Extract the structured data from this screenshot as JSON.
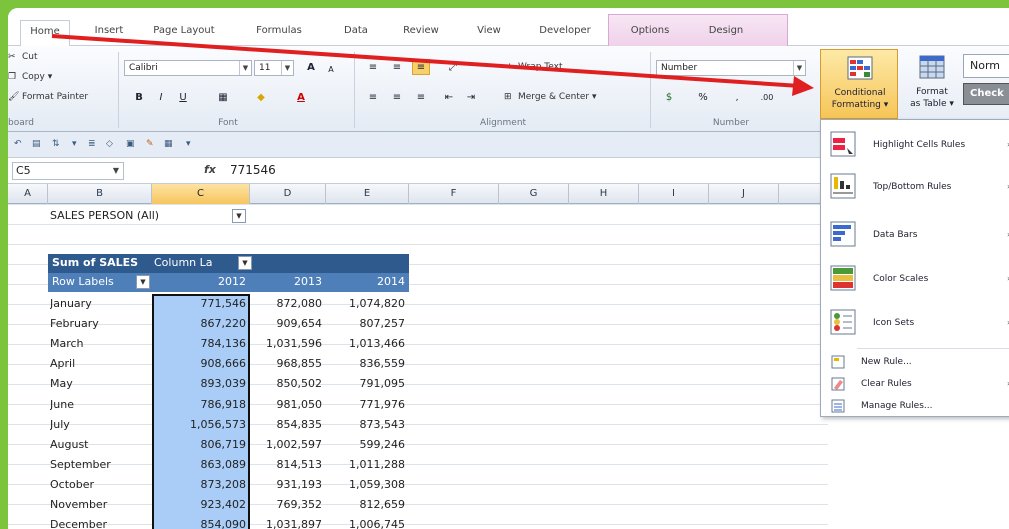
{
  "tabs": [
    {
      "label": "Home",
      "active": true
    },
    {
      "label": "Insert"
    },
    {
      "label": "Page Layout"
    },
    {
      "label": "Formulas"
    },
    {
      "label": "Data"
    },
    {
      "label": "Review"
    },
    {
      "label": "View"
    },
    {
      "label": "Developer"
    },
    {
      "label": "Options"
    },
    {
      "label": "Design"
    }
  ],
  "ribbon": {
    "clipboard": {
      "cut": "Cut",
      "copy": "Copy ▾",
      "format_painter": "Format Painter",
      "label": "board"
    },
    "font": {
      "name": "Calibri",
      "size": "11",
      "label": "Font"
    },
    "alignment": {
      "wrap_text": "Wrap Text",
      "merge_center": "Merge & Center ▾",
      "label": "Alignment"
    },
    "number": {
      "format": "Number",
      "percent": "%",
      "label": "Number"
    },
    "styles": {
      "cf_line1": "Conditional",
      "cf_line2": "Formatting ▾",
      "ft_line1": "Format",
      "ft_line2": "as Table ▾",
      "normal": "Norm",
      "check": "Check"
    }
  },
  "formula_bar": {
    "name_box": "C5",
    "fx": "fx",
    "value": "771546"
  },
  "columns": [
    "A",
    "B",
    "C",
    "D",
    "E",
    "F",
    "G",
    "H",
    "I",
    "J"
  ],
  "pivot": {
    "filter_label": "SALES PERSON",
    "filter_value": "(All)",
    "sum_label": "Sum of SALES",
    "column_labels": "Column La",
    "row_labels": "Row Labels",
    "years": [
      "2012",
      "2013",
      "2014"
    ],
    "rows": [
      {
        "month": "January",
        "v2012": "771,546",
        "v2013": "872,080",
        "v2014": "1,074,820"
      },
      {
        "month": "February",
        "v2012": "867,220",
        "v2013": "909,654",
        "v2014": "807,257"
      },
      {
        "month": "March",
        "v2012": "784,136",
        "v2013": "1,031,596",
        "v2014": "1,013,466"
      },
      {
        "month": "April",
        "v2012": "908,666",
        "v2013": "968,855",
        "v2014": "836,559"
      },
      {
        "month": "May",
        "v2012": "893,039",
        "v2013": "850,502",
        "v2014": "791,095"
      },
      {
        "month": "June",
        "v2012": "786,918",
        "v2013": "981,050",
        "v2014": "771,976"
      },
      {
        "month": "July",
        "v2012": "1,056,573",
        "v2013": "854,835",
        "v2014": "873,543"
      },
      {
        "month": "August",
        "v2012": "806,719",
        "v2013": "1,002,597",
        "v2014": "599,246"
      },
      {
        "month": "September",
        "v2012": "863,089",
        "v2013": "814,513",
        "v2014": "1,011,288"
      },
      {
        "month": "October",
        "v2012": "873,208",
        "v2013": "931,193",
        "v2014": "1,059,308"
      },
      {
        "month": "November",
        "v2012": "923,402",
        "v2013": "769,352",
        "v2014": "812,659"
      },
      {
        "month": "December",
        "v2012": "854,090",
        "v2013": "1,031,897",
        "v2014": "1,006,745"
      }
    ]
  },
  "cf_menu": {
    "items": [
      {
        "label": "Highlight Cells Rules",
        "submenu": true
      },
      {
        "label": "Top/Bottom Rules",
        "submenu": true
      },
      {
        "label": "Data Bars",
        "submenu": true
      },
      {
        "label": "Color Scales",
        "submenu": true
      },
      {
        "label": "Icon Sets",
        "submenu": true
      }
    ],
    "small_items": [
      {
        "label": "New Rule..."
      },
      {
        "label": "Clear Rules",
        "submenu": true
      },
      {
        "label": "Manage Rules..."
      }
    ]
  },
  "colors": {
    "accent_green": "#7cc43c",
    "pivot_dark": "#2f5a8e",
    "pivot_mid": "#4f7fb9",
    "selection": "#a9cdf6",
    "arrow": "#e02020"
  }
}
